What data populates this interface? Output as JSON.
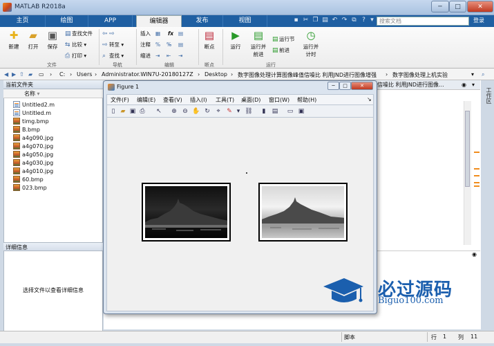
{
  "window": {
    "title": "MATLAB R2018a"
  },
  "tabs": [
    {
      "label": "主页"
    },
    {
      "label": "绘图"
    },
    {
      "label": "APP"
    },
    {
      "label": "编辑器"
    },
    {
      "label": "发布"
    },
    {
      "label": "视图"
    }
  ],
  "search": {
    "placeholder": "搜索文档"
  },
  "login": "登录",
  "ribbon": {
    "new": "新建",
    "open": "打开",
    "save": "保存",
    "find_files": "查找文件",
    "compare": "比较",
    "print": "打印",
    "goto": "转至",
    "find": "查找",
    "insert": "插入",
    "comment": "注释",
    "indent": "缩进",
    "fx": "fx",
    "breakpoints": "断点",
    "run": "运行",
    "run_advance": "运行并\n前进",
    "run_section": "运行节",
    "advance": "前进",
    "run_time": "运行并\n计时",
    "groups": {
      "file": "文件",
      "navigate": "导航",
      "edit": "编辑",
      "breakpoints": "断点",
      "run": "运行"
    }
  },
  "address": {
    "drive": "C:",
    "sep": "›",
    "segments": [
      "Users",
      "Administrator.WIN7U-20180127Z",
      "Desktop",
      "数字图像处理计算图像峰值信噪比 利用JND进行图像增强",
      "数字图像处理上机实验"
    ]
  },
  "current_folder": {
    "title": "当前文件夹",
    "col_name": "名称",
    "files": [
      {
        "name": "Untitled2.m",
        "type": "m"
      },
      {
        "name": "Untitled.m",
        "type": "m"
      },
      {
        "name": "timg.bmp",
        "type": "img"
      },
      {
        "name": "B.bmp",
        "type": "img"
      },
      {
        "name": "a4g090.jpg",
        "type": "img"
      },
      {
        "name": "a4g070.jpg",
        "type": "img"
      },
      {
        "name": "a4g050.jpg",
        "type": "img"
      },
      {
        "name": "a4g030.jpg",
        "type": "img"
      },
      {
        "name": "a4g010.jpg",
        "type": "img"
      },
      {
        "name": "60.bmp",
        "type": "img"
      },
      {
        "name": "023.bmp",
        "type": "img"
      }
    ]
  },
  "details": {
    "title": "详细信息",
    "hint": "选择文件以查看详细信息"
  },
  "editor_tab": "值信噪比 利用JND进行图像...",
  "side_label": "工作区",
  "figure": {
    "title": "Figure 1",
    "menus": [
      "文件(F)",
      "编辑(E)",
      "查看(V)",
      "插入(I)",
      "工具(T)",
      "桌面(D)",
      "窗口(W)",
      "帮助(H)"
    ]
  },
  "status": {
    "script": "脚本",
    "row_label": "行",
    "row": "1",
    "col_label": "列",
    "col": "11"
  },
  "watermark": {
    "big": "必过源码",
    "url": "Biguo100.com"
  },
  "colors": {
    "tabbar": "#1f5fa2",
    "accent_orange": "#f08c1c",
    "watermark_blue": "#1b5fae"
  }
}
